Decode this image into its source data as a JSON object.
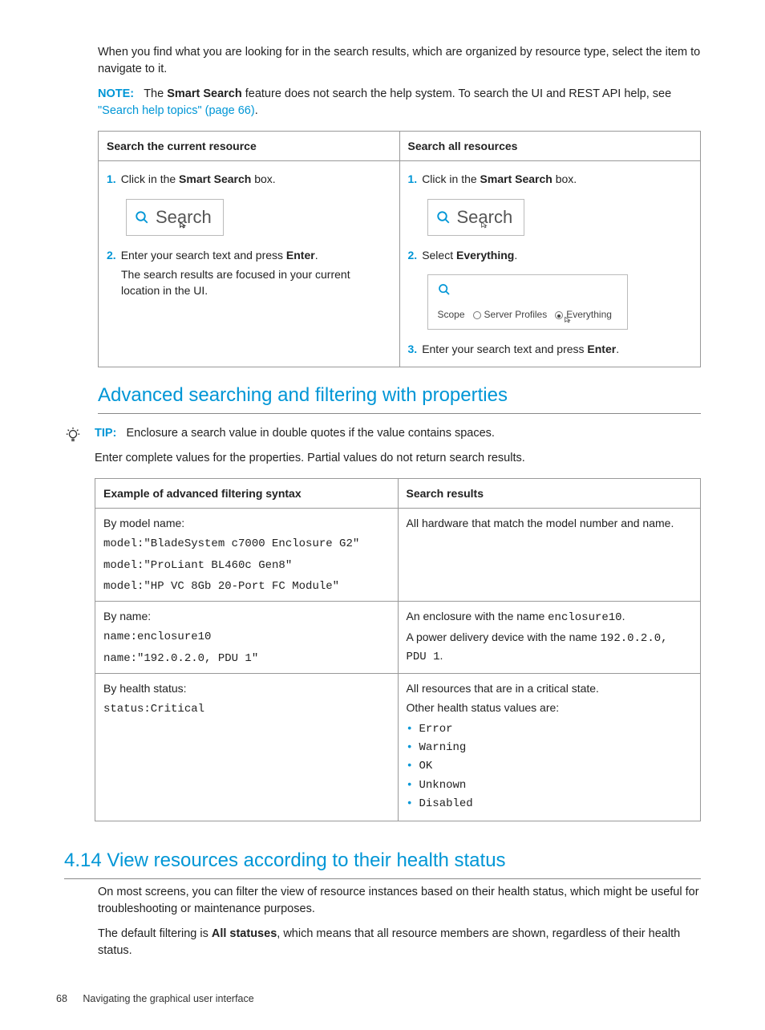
{
  "intro": {
    "p1": "When you find what you are looking for in the search results, which are organized by resource type, select the item to navigate to it.",
    "note_label": "NOTE:",
    "note_text1": "The ",
    "note_bold": "Smart Search",
    "note_text2": " feature does not search the help system. To search the UI and REST API help, see ",
    "note_link": "\"Search help topics\" (page 66)",
    "note_text3": "."
  },
  "searchTable": {
    "h1": "Search the current resource",
    "h2": "Search all resources",
    "left": {
      "s1a": "Click in the ",
      "s1b": "Smart Search",
      "s1c": " box.",
      "search_label": "Search",
      "s2a": "Enter your search text and press ",
      "s2b": "Enter",
      "s2c": ".",
      "s2sub": "The search results are focused in your current location in the UI."
    },
    "right": {
      "s1a": "Click in the ",
      "s1b": "Smart Search",
      "s1c": " box.",
      "search_label": "Search",
      "s2a": "Select ",
      "s2b": "Everything",
      "s2c": ".",
      "scope_label": "Scope",
      "scope_opt1": "Server Profiles",
      "scope_opt2": "Everything",
      "s3a": "Enter your search text and press ",
      "s3b": "Enter",
      "s3c": "."
    }
  },
  "advanced": {
    "heading": "Advanced searching and filtering with properties",
    "tip_label": "TIP:",
    "tip_text": "Enclosure a search value in double quotes if the value contains spaces.",
    "tip_sub": "Enter complete values for the properties. Partial values do not return search results.",
    "table": {
      "h1": "Example of advanced filtering syntax",
      "h2": "Search results",
      "r1": {
        "label": "By model name:",
        "c1": "model:\"BladeSystem c7000 Enclosure G2\"",
        "c2": "model:\"ProLiant BL460c Gen8\"",
        "c3": "model:\"HP VC 8Gb 20-Port FC Module\"",
        "res": "All hardware that match the model number and name."
      },
      "r2": {
        "label": "By name:",
        "c1": "name:enclosure10",
        "c2": "name:\"192.0.2.0, PDU 1\"",
        "res1a": "An enclosure with the name ",
        "res1b": "enclosure10",
        "res1c": ".",
        "res2a": "A power delivery device with the name ",
        "res2b": "192.0.2.0, PDU 1",
        "res2c": "."
      },
      "r3": {
        "label": "By health status:",
        "c1": "status:Critical",
        "res1": "All resources that are in a critical state.",
        "res2": "Other health status values are:",
        "b1": "Error",
        "b2": "Warning",
        "b3": "OK",
        "b4": "Unknown",
        "b5": "Disabled"
      }
    }
  },
  "section414": {
    "heading": "4.14 View resources according to their health status",
    "p1": "On most screens, you can filter the view of resource instances based on their health status, which might be useful for troubleshooting or maintenance purposes.",
    "p2a": "The default filtering is ",
    "p2b": "All statuses",
    "p2c": ", which means that all resource members are shown, regardless of their health status."
  },
  "footer": {
    "page": "68",
    "title": "Navigating the graphical user interface"
  }
}
